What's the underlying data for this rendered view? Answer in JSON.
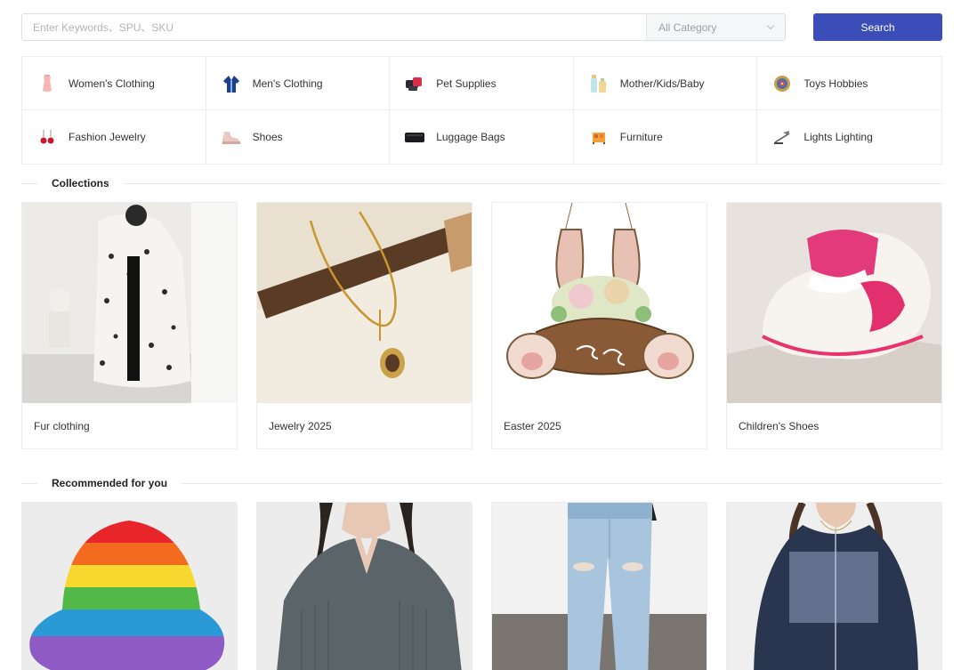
{
  "search": {
    "placeholder": "Enter Keywords、SPU、SKU",
    "value": "",
    "category_selected": "All Category",
    "button_label": "Search"
  },
  "categories": [
    {
      "label": "Women's Clothing",
      "icon": "womens-clothing-icon"
    },
    {
      "label": "Men's Clothing",
      "icon": "mens-clothing-icon"
    },
    {
      "label": "Pet Supplies",
      "icon": "pet-supplies-icon"
    },
    {
      "label": "Mother/Kids/Baby",
      "icon": "baby-bottle-icon"
    },
    {
      "label": "Toys Hobbies",
      "icon": "toy-icon"
    },
    {
      "label": "Fashion Jewelry",
      "icon": "earrings-icon"
    },
    {
      "label": "Shoes",
      "icon": "shoe-icon"
    },
    {
      "label": "Luggage Bags",
      "icon": "bag-icon"
    },
    {
      "label": "Furniture",
      "icon": "furniture-icon"
    },
    {
      "label": "Lights Lighting",
      "icon": "lamp-icon"
    }
  ],
  "collections": {
    "title": "Collections",
    "items": [
      {
        "label": "Fur clothing",
        "image": "fur-coat-photo"
      },
      {
        "label": "Jewelry 2025",
        "image": "gold-necklace-photo"
      },
      {
        "label": "Easter 2025",
        "image": "easter-bunny-sign-photo"
      },
      {
        "label": "Children's Shoes",
        "image": "crochet-baby-shoe-photo"
      }
    ]
  },
  "recommended": {
    "title": "Recommended for you",
    "items": [
      {
        "image": "rainbow-bucket-hat-photo"
      },
      {
        "image": "grey-knit-top-photo"
      },
      {
        "image": "ripped-jeans-photo"
      },
      {
        "image": "navy-zip-hoodie-photo"
      }
    ]
  },
  "colors": {
    "accent": "#3b4db8",
    "border": "#ebedf0",
    "text": "#333333"
  }
}
